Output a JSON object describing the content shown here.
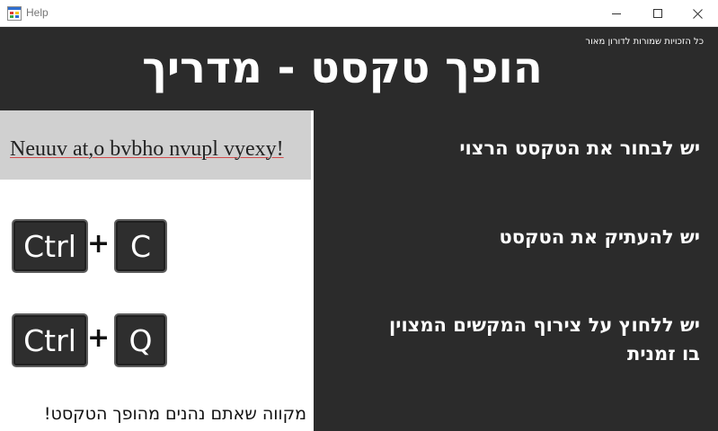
{
  "window": {
    "title": "Help",
    "icon": "app-form-icon",
    "controls": [
      "minimize-icon",
      "maximize-icon",
      "close-icon"
    ]
  },
  "header": {
    "copyright": "כל הזכויות שמורות לדורון מאור",
    "title": "הופך טקסט - מדריך"
  },
  "example": {
    "sample_text": "Neuuv at,o bvbho nvupl vyexy!"
  },
  "shortcuts": [
    {
      "keys": [
        "Ctrl",
        "C"
      ],
      "separator": "+"
    },
    {
      "keys": [
        "Ctrl",
        "Q"
      ],
      "separator": "+"
    }
  ],
  "steps": [
    {
      "lines": [
        "יש לבחור את הטקסט הרצוי"
      ]
    },
    {
      "lines": [
        "יש להעתיק את הטקסט"
      ]
    },
    {
      "lines": [
        "יש ללחוץ על צירוף המקשים המצוין",
        "בו זמנית"
      ]
    }
  ],
  "closing": "מקווה שאתם נהנים מהופך הטקסט!",
  "colors": {
    "background": "#2b2b2b",
    "panel": "#ffffff",
    "sample_box": "#d0d0d0",
    "key_face": "#2e2e2e",
    "key_border": "#5e5e5e"
  }
}
